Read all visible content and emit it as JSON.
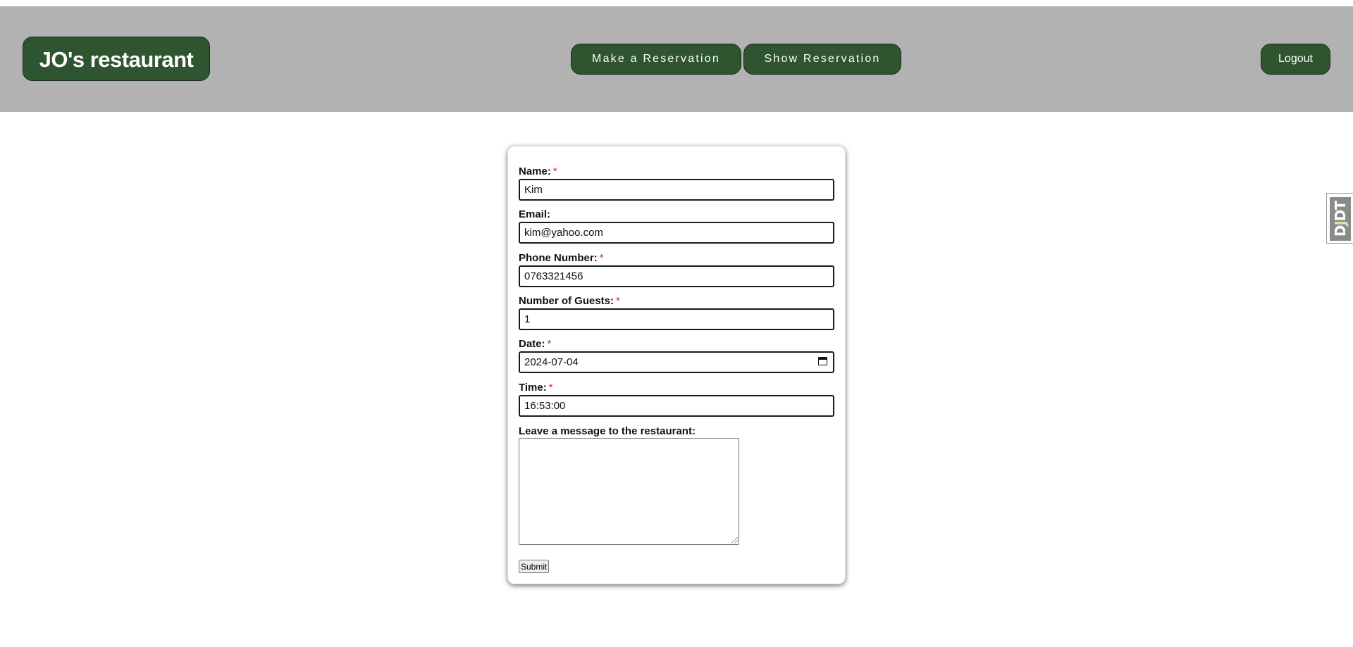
{
  "header": {
    "brand": "JO's restaurant",
    "nav": {
      "make_reservation": "Make a Reservation",
      "show_reservation": "Show Reservation"
    },
    "logout": "Logout"
  },
  "form": {
    "fields": {
      "name": {
        "label": "Name:",
        "required": "*",
        "value": "Kim"
      },
      "email": {
        "label": "Email:",
        "value": "kim@yahoo.com"
      },
      "phone": {
        "label": "Phone Number:",
        "required": "*",
        "value": "0763321456"
      },
      "guests": {
        "label": "Number of Guests:",
        "required": "*",
        "value": "1"
      },
      "date": {
        "label": "Date:",
        "required": "*",
        "value": "2024-07-04"
      },
      "time": {
        "label": "Time:",
        "required": "*",
        "value": "16:53:00"
      },
      "message": {
        "label": "Leave a message to the restaurant:",
        "value": ""
      }
    },
    "submit_label": "Submit"
  },
  "debug_toolbar": {
    "d": "D",
    "j": "J",
    "dt": "DT"
  },
  "colors": {
    "navbar_bg": "#b2b2b2",
    "button_green": "#2f5430",
    "required_red": "#e02020"
  },
  "icons": {
    "date_picker": "calendar-icon"
  }
}
